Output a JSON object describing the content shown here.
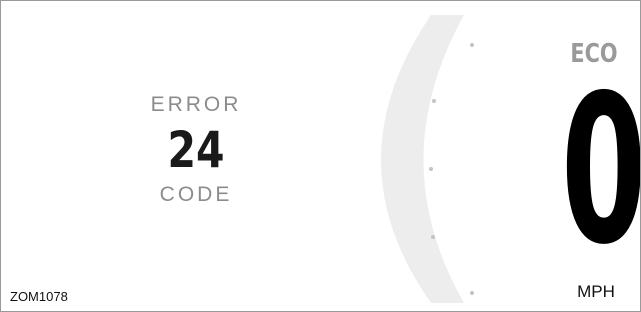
{
  "error": {
    "label": "ERROR",
    "code": "24",
    "code_label": "CODE"
  },
  "mode": "ECO",
  "speed": {
    "value": "0",
    "unit": "MPH"
  },
  "vehicle_id": "ZOM1078",
  "colors": {
    "arc": "#ededed",
    "tick": "#c4c4c4",
    "text_muted": "#8c8c8c",
    "text_main": "#111111"
  }
}
